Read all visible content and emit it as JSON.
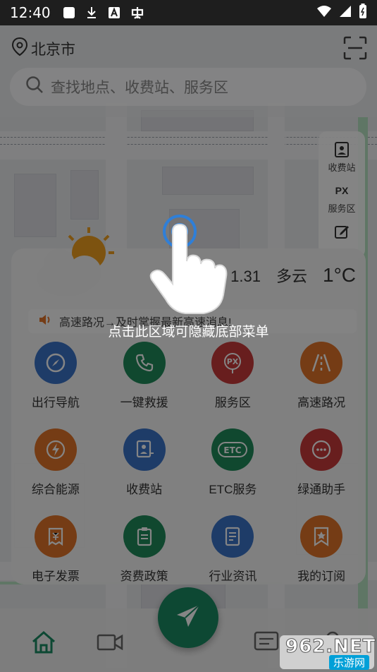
{
  "status_bar": {
    "time": "12:40"
  },
  "header": {
    "city": "北京市",
    "search_placeholder": "查找地点、收费站、服务区"
  },
  "side_tools": [
    {
      "label": "收费站",
      "icon": "toll-station-icon"
    },
    {
      "label": "服务区",
      "icon": "px-service-icon",
      "glyph": "PX"
    },
    {
      "label": "",
      "icon": "edit-icon"
    }
  ],
  "weather": {
    "date": "1.31",
    "condition": "多云",
    "temperature": "1°C"
  },
  "notice": {
    "text": "高速路况→及时掌握最新高速消息!"
  },
  "hint": {
    "text": "点击此区域可隐藏底部菜单"
  },
  "menu": [
    {
      "label": "出行导航",
      "icon": "compass-icon",
      "color": "#3b73c8"
    },
    {
      "label": "一键救援",
      "icon": "phone-icon",
      "color": "#1f8a5a"
    },
    {
      "label": "服务区",
      "icon": "px-service-icon",
      "color": "#c83a3a",
      "glyph": "PX"
    },
    {
      "label": "高速路况",
      "icon": "road-icon",
      "color": "#e0742a"
    },
    {
      "label": "综合能源",
      "icon": "lightning-icon",
      "color": "#e0742a"
    },
    {
      "label": "收费站",
      "icon": "toll-booth-icon",
      "color": "#3b73c8"
    },
    {
      "label": "ETC服务",
      "icon": "etc-icon",
      "color": "#1f8a5a",
      "glyph": "ETC"
    },
    {
      "label": "绿通助手",
      "icon": "chat-icon",
      "color": "#c83a3a"
    },
    {
      "label": "电子发票",
      "icon": "invoice-icon",
      "color": "#e0742a"
    },
    {
      "label": "资费政策",
      "icon": "clipboard-icon",
      "color": "#1f8a5a"
    },
    {
      "label": "行业资讯",
      "icon": "document-icon",
      "color": "#3b73c8"
    },
    {
      "label": "我的订阅",
      "icon": "subscription-icon",
      "color": "#e0742a"
    }
  ],
  "bottom_nav": [
    "home-icon",
    "video-icon",
    "message-icon",
    "user-icon"
  ],
  "watermark": {
    "brand": "962.NET",
    "subtitle": "乐游网"
  },
  "colors": {
    "primary": "#1a8a63",
    "status_bar": "#1e1e1e"
  }
}
